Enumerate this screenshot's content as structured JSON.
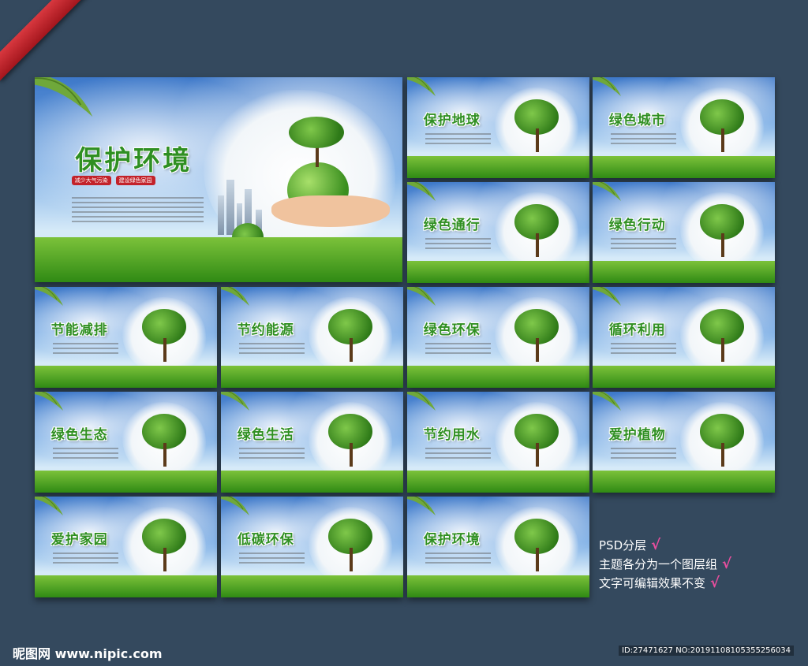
{
  "main": {
    "title": "保护环境",
    "badges": [
      "减少大气污染",
      "建设绿色家园"
    ]
  },
  "cards": [
    {
      "title": "保护地球",
      "art": "globe-hand-icon"
    },
    {
      "title": "绿色城市",
      "art": "green-city-icon"
    },
    {
      "title": "绿色通行",
      "art": "green-battery-icon"
    },
    {
      "title": "绿色行动",
      "art": "heart-hands-icon"
    },
    {
      "title": "节能减排",
      "art": "green-car-icon"
    },
    {
      "title": "节约能源",
      "art": "grass-fuel-pump-icon"
    },
    {
      "title": "绿色环保",
      "art": "tree-people-icon"
    },
    {
      "title": "循环利用",
      "art": "recycle-arrows-icon"
    },
    {
      "title": "绿色生态",
      "art": "tree-icon"
    },
    {
      "title": "绿色生活",
      "art": "recycle-bin-tree-icon"
    },
    {
      "title": "节约用水",
      "art": "earth-faucet-icon"
    },
    {
      "title": "爱护植物",
      "art": "floating-island-icon"
    },
    {
      "title": "爱护家园",
      "art": "grass-house-icon"
    },
    {
      "title": "低碳环保",
      "art": "grass-car-icon"
    },
    {
      "title": "保护环境",
      "art": "globe-hand-icon"
    }
  ],
  "note": {
    "lines": [
      "PSD分层",
      "主题各分为一个图层组",
      "文字可编辑效果不变"
    ],
    "check_mark": "√"
  },
  "footer": {
    "logo": "昵图网 www.nipic.com",
    "id_text": "ID:27471627 NO:20191108105355256034"
  }
}
